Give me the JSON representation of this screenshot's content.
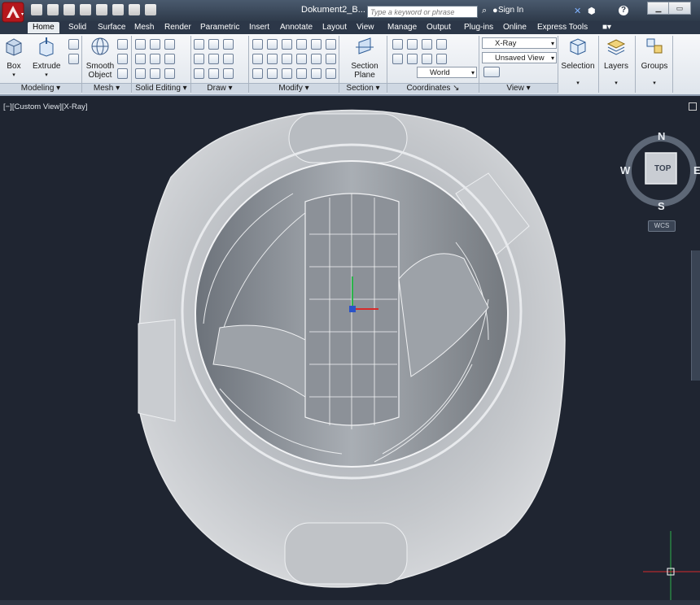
{
  "titlebar": {
    "document_title": "Dokument2_B...",
    "search_placeholder": "Type a keyword or phrase",
    "sign_in": "Sign In",
    "help": "?"
  },
  "tabs": [
    "Home",
    "Solid",
    "Surface",
    "Mesh",
    "Render",
    "Parametric",
    "Insert",
    "Annotate",
    "Layout",
    "View",
    "Manage",
    "Output",
    "Plug-ins",
    "Online",
    "Express Tools"
  ],
  "ribbon": {
    "modeling": {
      "label": "Modeling",
      "box": "Box",
      "extrude": "Extrude"
    },
    "mesh": {
      "label": "Mesh",
      "smooth1": "Smooth",
      "smooth2": "Object"
    },
    "solid_editing": {
      "label": "Solid Editing"
    },
    "draw": {
      "label": "Draw"
    },
    "modify": {
      "label": "Modify"
    },
    "section": {
      "label": "Section",
      "btn1": "Section",
      "btn2": "Plane"
    },
    "coordinates": {
      "label": "Coordinates",
      "world": "World"
    },
    "view": {
      "label": "View",
      "visual_style": "X-Ray",
      "saved_view": "Unsaved View"
    },
    "selection": "Selection",
    "layers": "Layers",
    "groups": "Groups"
  },
  "viewport": {
    "label": "[−][Custom View][X-Ray]",
    "viewcube_face": "TOP",
    "compass": {
      "n": "N",
      "s": "S",
      "e": "E",
      "w": "W"
    },
    "wcs": "WCS"
  },
  "colors": {
    "viewport_bg": "#1f2531",
    "ribbon_bg": "#e6ebf1",
    "accent": "#c81e1e"
  }
}
